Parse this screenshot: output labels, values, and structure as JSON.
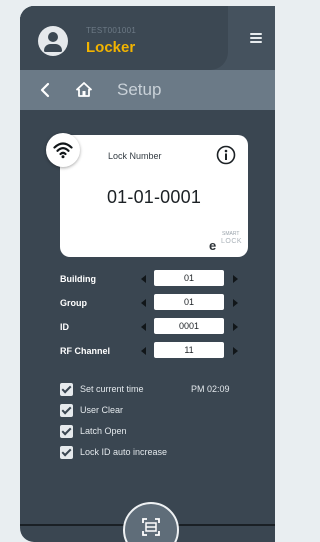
{
  "header": {
    "device_id": "TEST001001",
    "app_name": "Locker",
    "icons": {
      "avatar": "user-avatar-icon",
      "menu": "hamburger-menu-icon"
    }
  },
  "nav": {
    "title": "Setup",
    "icons": {
      "back": "chevron-left-icon",
      "home": "home-icon"
    }
  },
  "card": {
    "label": "Lock Number",
    "lock_number": "01-01-0001",
    "logo_top": "SMART",
    "logo_mark": "e",
    "logo_bottom": "LOCK",
    "icons": {
      "badge": "wifi-icon",
      "info": "info-icon"
    }
  },
  "form": {
    "rows": [
      {
        "label": "Building",
        "value": "01"
      },
      {
        "label": "Group",
        "value": "01"
      },
      {
        "label": "ID",
        "value": "0001"
      },
      {
        "label": "RF Channel",
        "value": "11"
      }
    ]
  },
  "options": [
    {
      "label": "Set current time",
      "checked": true
    },
    {
      "label": "User Clear",
      "checked": true
    },
    {
      "label": "Latch Open",
      "checked": true
    },
    {
      "label": "Lock ID auto increase",
      "checked": true
    }
  ],
  "current_time": "PM 02:09",
  "bottom": {
    "icons": {
      "scan": "scan-icon"
    }
  },
  "colors": {
    "accent": "#f2b400",
    "background": "#3a4651",
    "nav_bar": "#6b7a87",
    "card": "#ffffff"
  }
}
